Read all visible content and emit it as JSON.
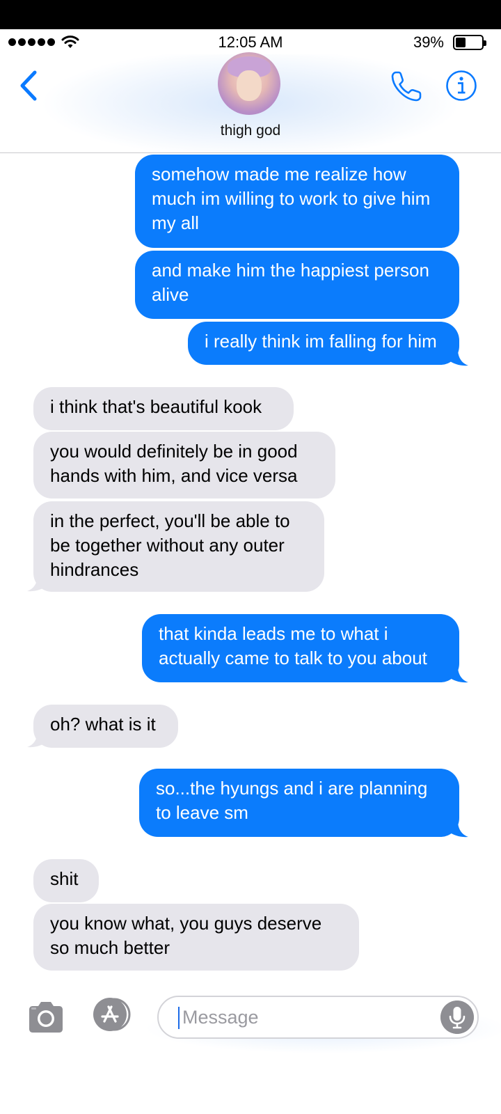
{
  "status_bar": {
    "time": "12:05 AM",
    "battery_percent": "39%",
    "battery_level": 0.39,
    "signal_bars": 5
  },
  "header": {
    "contact_name": "thigh god",
    "back_icon": "chevron-left-icon",
    "call_icon": "phone-icon",
    "info_icon": "info-icon"
  },
  "messages": [
    {
      "direction": "outgoing",
      "text": "somehow made me realize how much im willing to work to give him my all"
    },
    {
      "direction": "outgoing",
      "text": "and make him the happiest person alive"
    },
    {
      "direction": "outgoing",
      "text": "i really think im falling for him"
    },
    {
      "direction": "incoming",
      "text": "i think that's beautiful kook"
    },
    {
      "direction": "incoming",
      "text": "you would definitely be in good hands with him, and vice versa"
    },
    {
      "direction": "incoming",
      "text": "in the perfect, you'll be able to be together without any outer hindrances"
    },
    {
      "direction": "outgoing",
      "text": "that kinda leads me to what i actually came to talk to you about"
    },
    {
      "direction": "incoming",
      "text": "oh? what is it"
    },
    {
      "direction": "outgoing",
      "text": "so...the hyungs and i are planning to leave sm"
    },
    {
      "direction": "incoming",
      "text": "shit"
    },
    {
      "direction": "incoming",
      "text": "you know what, you guys deserve so much better"
    }
  ],
  "composer": {
    "placeholder": "Message",
    "camera_icon": "camera-icon",
    "apps_icon": "app-store-icon",
    "mic_icon": "microphone-icon"
  },
  "colors": {
    "outgoing_bubble": "#0b7cfc",
    "incoming_bubble": "#e6e5eb",
    "accent": "#0a7aff"
  }
}
